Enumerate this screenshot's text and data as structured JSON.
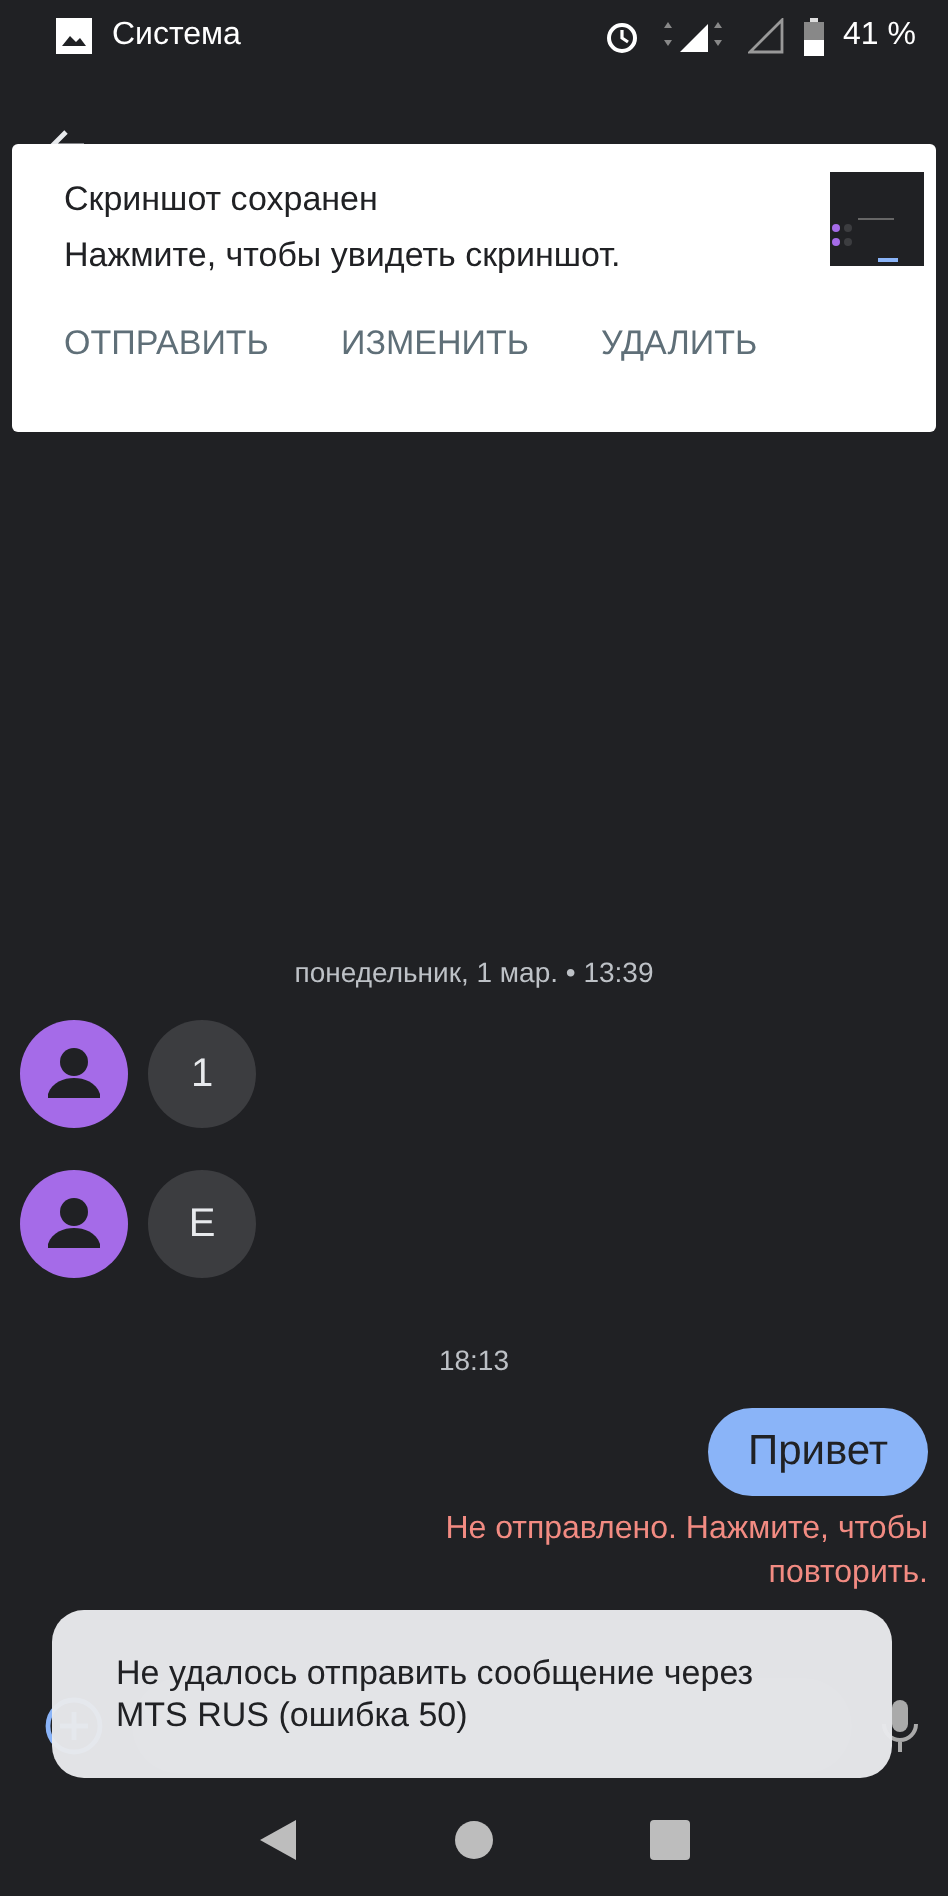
{
  "status_bar": {
    "app_name": "Система",
    "battery": "41 %"
  },
  "notification": {
    "title": "Скриншот сохранен",
    "text": "Нажмите, чтобы увидеть скриншот.",
    "actions": [
      "ОТПРАВИТЬ",
      "ИЗМЕНИТЬ",
      "УДАЛИТЬ"
    ]
  },
  "messages": [
    {
      "kind": "date",
      "text": "понедельник, 1 мар. • 13:39"
    },
    {
      "kind": "incoming",
      "text": "1"
    },
    {
      "kind": "incoming",
      "text": "E"
    },
    {
      "kind": "date",
      "text": "18:13"
    },
    {
      "kind": "outgoing",
      "text": "Привет",
      "error": "Не отправлено. Нажмите, чтобы повторить."
    }
  ],
  "snackbar": {
    "text": "Не удалось отправить сообщение через MTS RUS (ошибка 50)"
  }
}
